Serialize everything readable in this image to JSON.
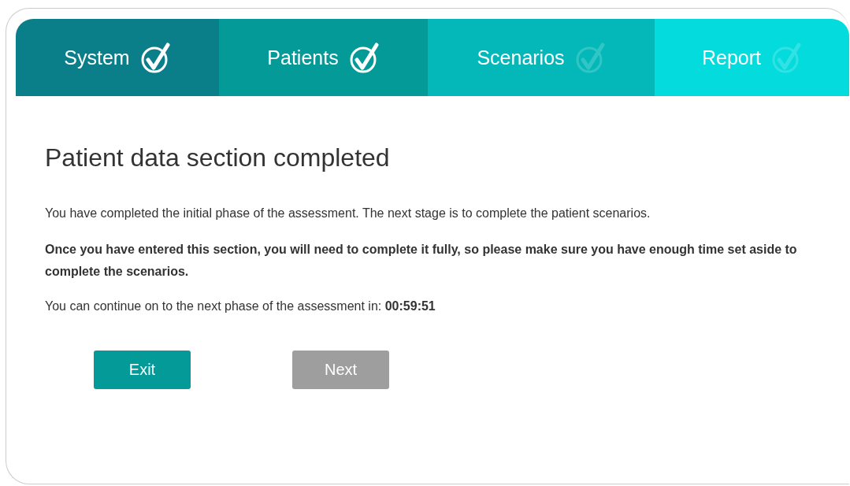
{
  "steps": [
    {
      "label": "System",
      "completed": true,
      "color": "#0a7f8a"
    },
    {
      "label": "Patients",
      "completed": true,
      "color": "#039a98"
    },
    {
      "label": "Scenarios",
      "completed": false,
      "color": "#04b8b9"
    },
    {
      "label": "Report",
      "completed": false,
      "color": "#03dbdd"
    }
  ],
  "heading": "Patient data section completed",
  "intro": "You have completed the initial phase of the assessment. The next stage is to complete the patient scenarios.",
  "warning": "Once you have entered this section, you will need to complete it fully, so please make sure you have enough time set aside to complete the scenarios.",
  "countdown": "You can continue on to the next phase of the assessment in: **00:59:51**",
  "buttons": [
    {
      "label": "Exit",
      "disabled": false
    },
    {
      "label": "Next",
      "disabled": true
    }
  ]
}
